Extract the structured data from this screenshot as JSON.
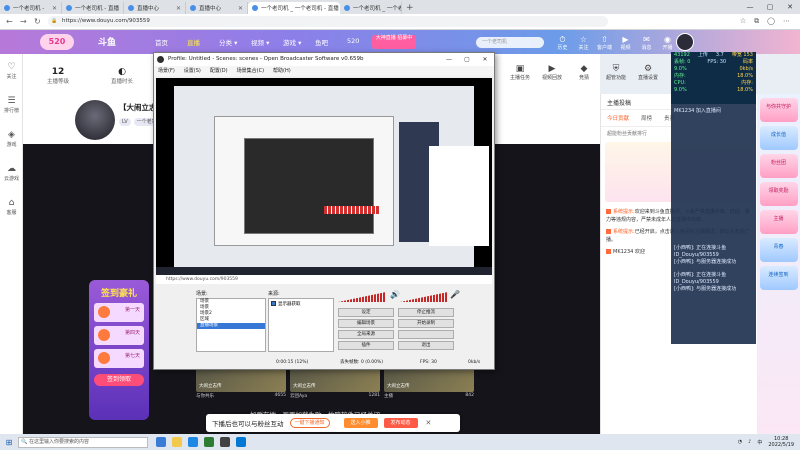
{
  "browser": {
    "tabs": [
      {
        "label": "一个老司机 -",
        "active": false
      },
      {
        "label": "一个老司机 - 直播",
        "active": false
      },
      {
        "label": "直播中心",
        "active": false
      },
      {
        "label": "直播中心",
        "active": false
      },
      {
        "label": "一个老司机 _ 一个老司机 - 直播",
        "active": true
      },
      {
        "label": "一个老司机 _ 一个老司机 - 直播",
        "active": false
      }
    ],
    "new_tab": "+",
    "url": "https://www.douyu.com/903559",
    "window_controls": [
      "—",
      "▢",
      "✕"
    ]
  },
  "site": {
    "logo_text": "520",
    "brand": "斗鱼",
    "nav": [
      {
        "label": "首页",
        "active": false
      },
      {
        "label": "直播",
        "active": true
      },
      {
        "label": "分类 ▾",
        "active": false
      },
      {
        "label": "视频 ▾",
        "active": false
      },
      {
        "label": "游戏 ▾",
        "active": false
      },
      {
        "label": "鱼吧",
        "active": false
      },
      {
        "label": "520",
        "active": false
      }
    ],
    "promo": "大神直播 招募中",
    "search_placeholder": "一个老司机",
    "header_icons": [
      {
        "icon": "history-icon",
        "glyph": "⏱",
        "label": "历史"
      },
      {
        "icon": "follow-icon",
        "glyph": "☆",
        "label": "关注"
      },
      {
        "icon": "upload-icon",
        "glyph": "⇧",
        "label": "客户端"
      },
      {
        "icon": "video-icon",
        "glyph": "▶",
        "label": "视频"
      },
      {
        "icon": "chat-icon",
        "glyph": "✉",
        "label": "消息"
      },
      {
        "icon": "live-icon",
        "glyph": "◉",
        "label": "开播"
      }
    ]
  },
  "left_rail": [
    {
      "icon": "heart-icon",
      "glyph": "♡",
      "label": "关注"
    },
    {
      "icon": "ranking-icon",
      "glyph": "☰",
      "label": "排行榜"
    },
    {
      "icon": "game-icon",
      "glyph": "◈",
      "label": "游戏"
    },
    {
      "icon": "cloud-game-icon",
      "glyph": "☁",
      "label": "云游戏"
    },
    {
      "icon": "home-icon",
      "glyph": "⌂",
      "label": "客服"
    }
  ],
  "room": {
    "follow_count": "12",
    "follow_label": "主播等级",
    "stat2_label": "直播时长",
    "anchor_name": "【大闹立志",
    "anchor_tags": [
      "LV",
      "一个老司"
    ],
    "right_icons": [
      {
        "icon": "gift-icon",
        "glyph": "▣",
        "label": "主播任务"
      },
      {
        "icon": "video-rec-icon",
        "glyph": "▶",
        "label": "视频回放"
      },
      {
        "icon": "quiz-icon",
        "glyph": "◆",
        "label": "竞猜"
      },
      {
        "icon": "shield-icon",
        "glyph": "⛨",
        "label": "超管功能"
      },
      {
        "icon": "settings-icon",
        "glyph": "⚙",
        "label": "直播设置"
      }
    ]
  },
  "signin": {
    "title": "签到豪礼",
    "days": [
      "第一天",
      "第四天",
      "第七天"
    ],
    "button": "签到领取"
  },
  "thumbs": [
    {
      "title": "大闹立志传",
      "host": "与你共乐",
      "viewers": "4655"
    },
    {
      "title": "大闹立志传",
      "host": "云团Aya",
      "viewers": "1281"
    },
    {
      "title": "大闹立志传",
      "host": "主播",
      "viewers": "842"
    }
  ],
  "bottom_strip": "加群在地，画面加载失败，故障软件已经关闭",
  "banner": {
    "text": "下播后也可以与粉丝互动",
    "b1": "一键下播通知",
    "b2": "送入小推",
    "b3": "发布动态",
    "close": "✕"
  },
  "chat": {
    "header": "主播投稿",
    "tabs": [
      {
        "label": "今日贡献",
        "active": true
      },
      {
        "label": "周榜",
        "active": false
      },
      {
        "label": "贵宾",
        "active": false
      }
    ],
    "sub": "超能粉丝贡献排行",
    "messages": [
      {
        "tag": "系统提示:",
        "text": "欢迎来到斗鱼直播间，斗鱼严禁直播涉黄、低俗、暴力等违规内容，严禁未成年人在直播中出镜。"
      },
      {
        "tag": "系统提示:",
        "text": "已经开启，点击进入房间对主播播送，默认为友情广播。"
      },
      {
        "tag": "",
        "text": "MK1234 欢迎"
      }
    ]
  },
  "right_rail": [
    {
      "label": "与你共守护",
      "blue": false
    },
    {
      "label": "成长值",
      "blue": true
    },
    {
      "label": "粉丝团",
      "blue": false
    },
    {
      "label": "领取奖励",
      "blue": false
    },
    {
      "label": "主播",
      "blue": false
    },
    {
      "label": "青春",
      "blue": true
    },
    {
      "label": "连续签到",
      "blue": true
    }
  ],
  "stats_overlay": {
    "rows": [
      [
        "43192",
        "上传",
        "3.7",
        "带宽 153"
      ],
      [
        "丢帧: 0",
        "FPS: 30",
        "码率"
      ],
      [
        "9.0%",
        "",
        "0kb/s"
      ],
      [
        "内存:",
        "",
        "18.0%"
      ],
      [
        "CPU:",
        "",
        "内存:"
      ],
      [
        "9.0%",
        "",
        "18.0%"
      ]
    ]
  },
  "log_overlay": {
    "line1": "MK1234 加入直播间",
    "lines": [
      "[小西鸭]: 正在连接斗鱼 ID_Douyu/903559",
      "[小西鸭]: 与服务器连接成功",
      "[小西鸭]: 正在连接斗鱼 ID_Douyu/903559",
      "[小西鸭]: 与服务器连接成功"
    ]
  },
  "obs": {
    "title": "Profile: Untitled - Scenes: scenes - Open Broadcaster Software v0.659b",
    "menu": [
      "场景(F)",
      "设置(S)",
      "配置(D)",
      "场景集合(C)",
      "帮助(H)"
    ],
    "window_controls": [
      "—",
      "▢",
      "✕"
    ],
    "preview_url": "https://www.douyu.com/903559",
    "article_title": "经典版",
    "scenes_label": "场景:",
    "scenes": [
      {
        "name": "场景",
        "selected": false
      },
      {
        "name": "场景",
        "selected": false
      },
      {
        "name": "场景2",
        "selected": false
      },
      {
        "name": "区域",
        "selected": false
      },
      {
        "name": "直播场景",
        "selected": true
      }
    ],
    "sources_label": "来源:",
    "source": "显示器获取",
    "buttons": [
      "设定",
      "停止推流",
      "编辑场景",
      "开始录制",
      "全局来源",
      "",
      "插件",
      "退出"
    ],
    "status": {
      "time": "0:00:15 (12%)",
      "dropped": "丢失帧数: 0 (0.00%)",
      "fps": "FPS: 30",
      "bitrate": "0kb/s"
    }
  },
  "taskbar": {
    "search_placeholder": "在这里输入你要搜索的内容",
    "time": "10:28",
    "date": "2022/5/19",
    "tray": "中"
  }
}
